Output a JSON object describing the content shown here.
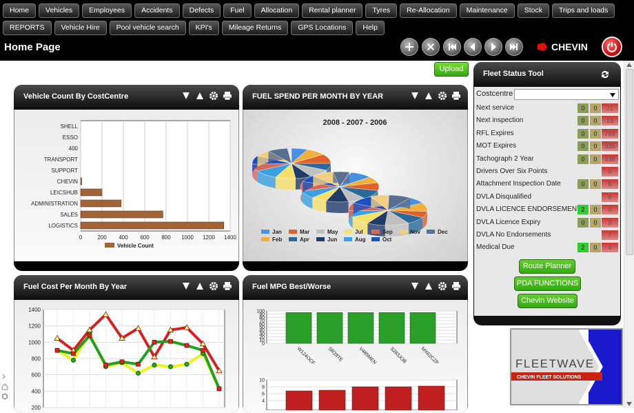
{
  "nav_row1": [
    "Home",
    "Vehicles",
    "Employees",
    "Accidents",
    "Defects",
    "Fuel",
    "Allocation",
    "Rental planner",
    "Tyres",
    "Re-Allocation",
    "Maintenance",
    "Stock",
    "Trips and loads"
  ],
  "nav_row2": [
    "REPORTS",
    "Vehicle Hire",
    "Pool vehicle search",
    "KPI's",
    "Mileage Returns",
    "GPS Locations",
    "Help"
  ],
  "page_title": "Home Page",
  "logo_text": "CHEVIN",
  "upload_label": "Upload",
  "widgets": {
    "vehicle_count": {
      "title": "Vehicle Count By CostCentre"
    },
    "fuel_spend": {
      "title": "FUEL SPEND PER MONTH BY YEAR"
    },
    "fuel_cost": {
      "title": "Fuel Cost Per Month By Year"
    },
    "fuel_mpg": {
      "title": "Fuel MPG Best/Worse"
    }
  },
  "fleet_status": {
    "title": "Fleet Status Tool",
    "costcentre_label": "Costcentre",
    "rows": [
      {
        "label": "Next service",
        "a": "0",
        "b": "0",
        "c": "21"
      },
      {
        "label": "Next inspection",
        "a": "0",
        "b": "0",
        "c": "13"
      },
      {
        "label": "RFL Expires",
        "a": "0",
        "b": "0",
        "c": "783"
      },
      {
        "label": "MOT Expires",
        "a": "0",
        "b": "0",
        "c": "535"
      },
      {
        "label": "Tachograph 2 Year",
        "a": "0",
        "b": "0",
        "c": "336"
      },
      {
        "label": "Drivers Over Six Points",
        "a": "",
        "b": "",
        "c": "0"
      },
      {
        "label": "Attachment Inspection Date",
        "a": "0",
        "b": "0",
        "c": "6"
      },
      {
        "label": "DVLA Disqualified",
        "a": "",
        "b": "",
        "c": "0"
      },
      {
        "label": "DVLA LICENCE ENDORSEMENTS",
        "a": "2",
        "b": "0",
        "c": "0"
      },
      {
        "label": "DVLA Licence Expiry",
        "a": "0",
        "b": "0",
        "c": "3"
      },
      {
        "label": "DVLA No Endorsements",
        "a": "",
        "b": "",
        "c": "7"
      },
      {
        "label": "Medical Due",
        "a": "2",
        "b": "0",
        "c": "4"
      }
    ],
    "buttons": [
      "Route Planner",
      "PDA FUNCTIONS",
      "Chevin Website"
    ]
  },
  "fleetwave_brand": {
    "name": "FLEETWAVE",
    "tagline": "CHEVIN FLEET SOLUTIONS"
  },
  "chart_data": [
    {
      "type": "bar",
      "orientation": "horizontal",
      "categories": [
        "SHELL",
        "ESSO",
        "400",
        "TRANSPORT",
        "SUPPORT",
        "CHEVIN",
        "LEICSHUB",
        "ADMINISTRATION",
        "SALES",
        "LOGISTICS"
      ],
      "values": [
        0,
        0,
        0,
        0,
        0,
        10,
        200,
        380,
        770,
        1340
      ],
      "xlim": [
        0,
        1400
      ],
      "xticks": [
        "0",
        "200",
        "400",
        "600",
        "800",
        "1000",
        "1200",
        "1400"
      ],
      "legend": "Vehicle Count",
      "color": "#a0643a"
    },
    {
      "type": "pie",
      "title": "2008 - 2007 - 2006",
      "pies": 3,
      "legend": [
        {
          "name": "Jan",
          "color": "#4a90e2"
        },
        {
          "name": "Mar",
          "color": "#e0622b"
        },
        {
          "name": "May",
          "color": "#c0c0c0"
        },
        {
          "name": "Jul",
          "color": "#f5e06a"
        },
        {
          "name": "Sep",
          "color": "#d46a5a"
        },
        {
          "name": "Nov",
          "color": "#f0d080"
        },
        {
          "name": "Dec",
          "color": "#5a6f8f"
        },
        {
          "name": "Feb",
          "color": "#f0b040"
        },
        {
          "name": "Apr",
          "color": "#2a6a9a"
        },
        {
          "name": "Jun",
          "color": "#203a6a"
        },
        {
          "name": "Aug",
          "color": "#3aa0e0"
        },
        {
          "name": "Oct",
          "color": "#1a50c0"
        }
      ]
    },
    {
      "type": "line",
      "ylim": [
        200,
        1400
      ],
      "yticks": [
        "200",
        "400",
        "600",
        "800",
        "1000",
        "1200",
        "1400"
      ],
      "series": [
        {
          "values": [
            1050,
            900,
            1150,
            1340,
            1050,
            1170,
            820,
            1150,
            1180,
            980,
            650
          ],
          "color": "#d42020",
          "marker": "triangle"
        },
        {
          "values": [
            900,
            780,
            1100,
            700,
            750,
            620,
            720,
            700,
            730,
            860,
            430
          ],
          "color": "#f0f020",
          "marker": "circle"
        },
        {
          "values": [
            900,
            860,
            1080,
            720,
            760,
            730,
            1000,
            1010,
            960,
            900,
            430
          ],
          "color": "#20a020",
          "marker": "square"
        }
      ]
    },
    {
      "type": "bar",
      "ylim": [
        0,
        100
      ],
      "yticks": [
        "0",
        "10",
        "20",
        "30",
        "40",
        "50",
        "60",
        "70",
        "80",
        "90",
        "100"
      ],
      "categories": [
        "W124OCF",
        "SR28TE",
        "V485MEN",
        "S283JOB",
        "MX62CZP"
      ],
      "values": [
        95,
        95,
        95,
        95,
        95
      ],
      "color": "#2aa02a"
    },
    {
      "type": "bar",
      "ylim": [
        4,
        10
      ],
      "yticks": [
        "4",
        "6",
        "8",
        "10"
      ],
      "values": [
        6.8,
        7.0,
        8.0,
        8.0,
        8.2
      ],
      "color": "#c02020"
    }
  ]
}
